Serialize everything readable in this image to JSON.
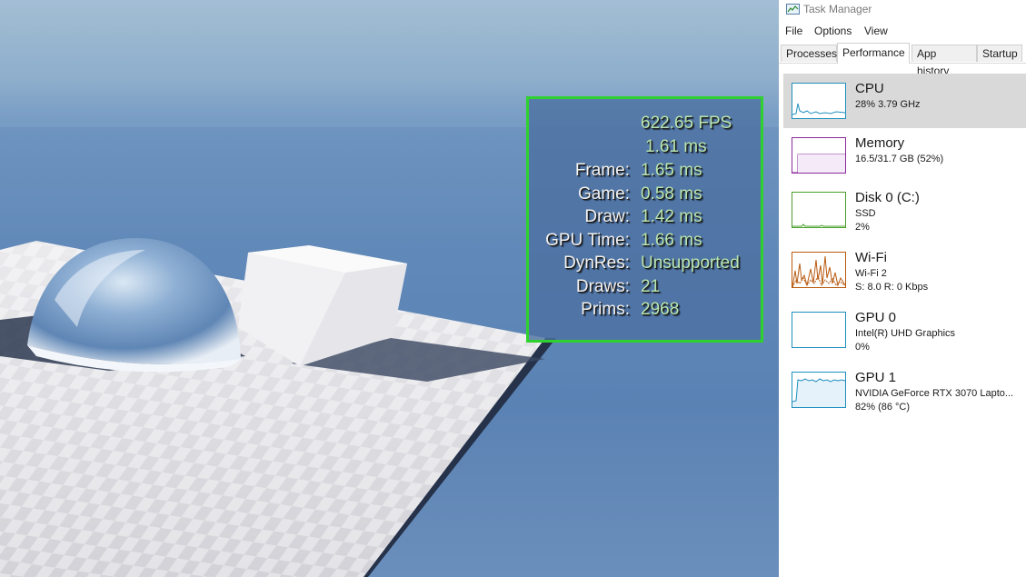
{
  "stats_overlay": {
    "fps": "622.65 FPS",
    "ms": "1.61 ms",
    "rows": [
      {
        "label": "Frame:",
        "value": "1.65 ms"
      },
      {
        "label": "Game:",
        "value": "0.58 ms"
      },
      {
        "label": "Draw:",
        "value": "1.42 ms"
      },
      {
        "label": "GPU Time:",
        "value": "1.66 ms"
      },
      {
        "label": "DynRes:",
        "value": "Unsupported"
      },
      {
        "label": "Draws:",
        "value": "21"
      },
      {
        "label": "Prims:",
        "value": "2968"
      }
    ],
    "border_color": "#2fd12f"
  },
  "task_manager": {
    "title": "Task Manager",
    "menu": [
      "File",
      "Options",
      "View"
    ],
    "tabs": [
      "Processes",
      "Performance",
      "App history",
      "Startup"
    ],
    "active_tab": "Performance",
    "items": [
      {
        "name": "CPU",
        "line1": "28% 3.79 GHz",
        "line2": "",
        "color": "#1f8fbf",
        "selected": true
      },
      {
        "name": "Memory",
        "line1": "16.5/31.7 GB (52%)",
        "line2": "",
        "color": "#8b2a9e",
        "selected": false
      },
      {
        "name": "Disk 0 (C:)",
        "line1": "SSD",
        "line2": "2%",
        "color": "#4aa02c",
        "selected": false
      },
      {
        "name": "Wi-Fi",
        "line1": "Wi-Fi 2",
        "line2": "S: 8.0  R: 0 Kbps",
        "color": "#b85a10",
        "selected": false
      },
      {
        "name": "GPU 0",
        "line1": "Intel(R) UHD Graphics",
        "line2": "0%",
        "color": "#1f8fbf",
        "selected": false
      },
      {
        "name": "GPU 1",
        "line1": "NVIDIA GeForce RTX 3070 Lapto...",
        "line2": "82%  (86 °C)",
        "color": "#1f8fbf",
        "selected": false
      }
    ]
  }
}
